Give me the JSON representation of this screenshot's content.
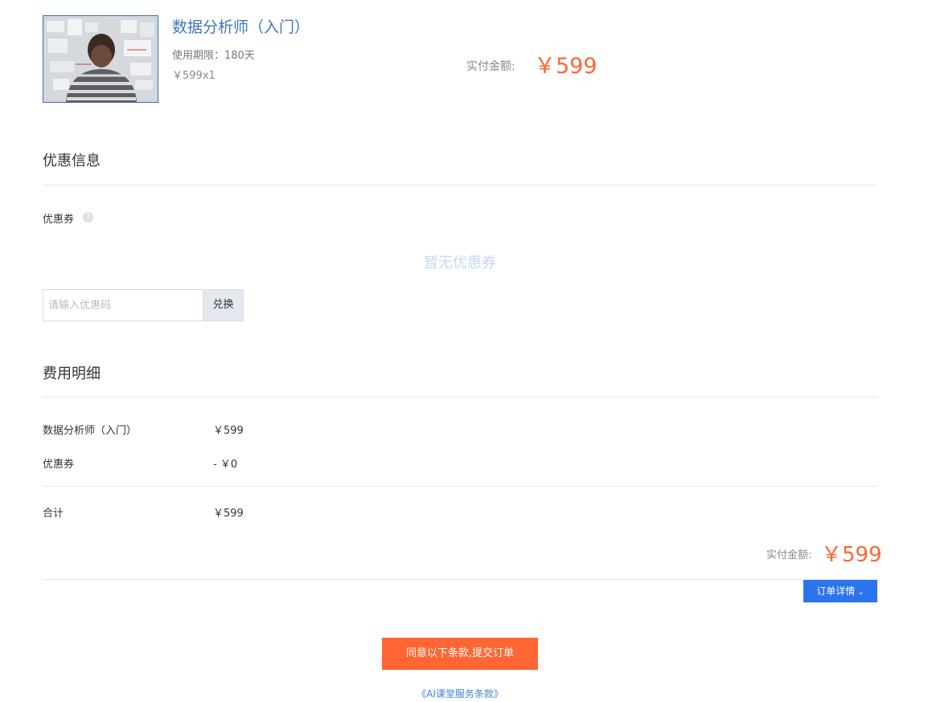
{
  "product": {
    "title": "数据分析师（入门）",
    "duration": "使用期限：180天",
    "unit_price": "￥599x1",
    "paid_label": "实付金额:",
    "paid_amount": "￥599"
  },
  "coupon_section": {
    "title": "优惠信息",
    "coupon_label": "优惠券",
    "help_icon": "question-icon",
    "empty_text": "暂无优惠券",
    "code_placeholder": "请输入优惠码",
    "code_value": "",
    "redeem_label": "兑换"
  },
  "fee_section": {
    "title": "费用明细",
    "items": [
      {
        "name": "数据分析师（入门）",
        "value": "￥599"
      },
      {
        "name": "优惠券",
        "value": "- ￥0"
      }
    ],
    "total": {
      "name": "合计",
      "value": "￥599"
    },
    "paid_label": "实付金额:",
    "paid_amount": "￥599"
  },
  "order_details_label": "订单详情",
  "submit_label": "同意以下条款,提交订单",
  "terms_link": "《AI课堂服务条款》",
  "colors": {
    "accent_orange": "#ff6633",
    "accent_blue": "#2b74ed",
    "title_blue": "#3e74c7"
  }
}
